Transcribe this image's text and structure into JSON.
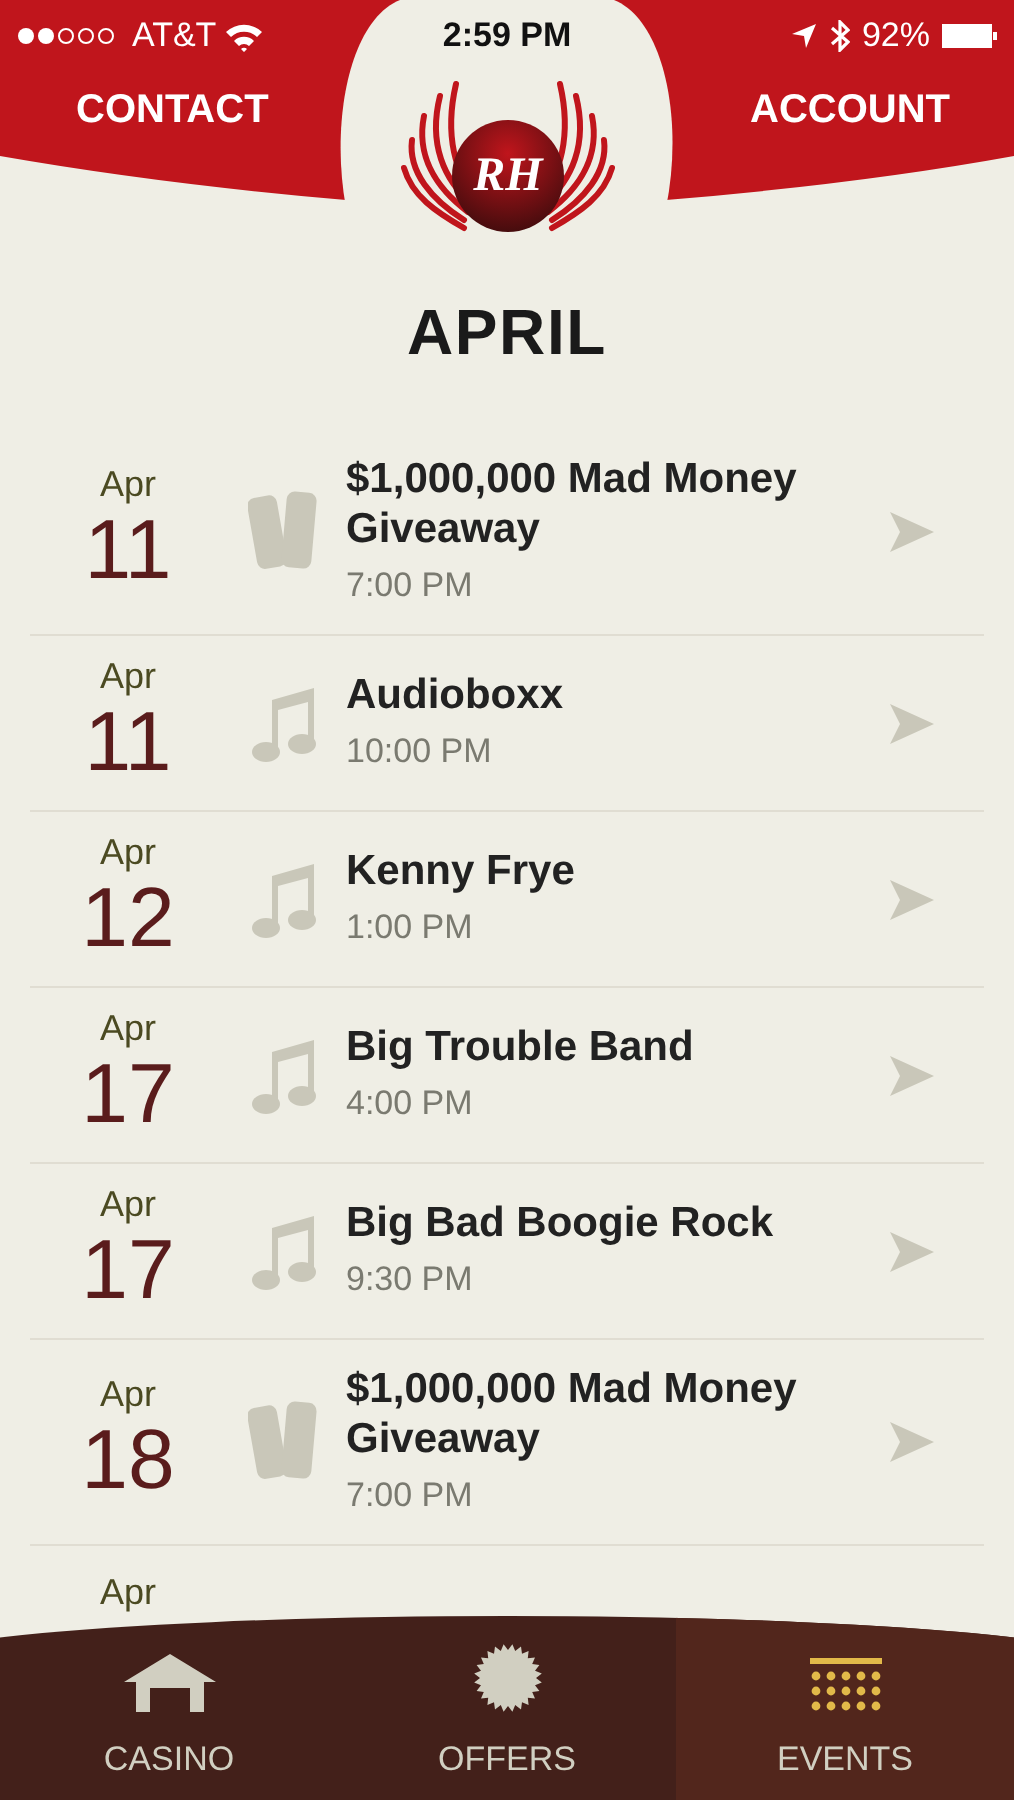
{
  "status_bar": {
    "carrier": "AT&T",
    "time": "2:59 PM",
    "battery": "92%"
  },
  "header": {
    "left": "CONTACT",
    "right": "ACCOUNT",
    "logo_text": "RH"
  },
  "month_title": "APRIL",
  "events": [
    {
      "month": "Apr",
      "day": "11",
      "kind": "tickets",
      "title": "$1,000,000 Mad Money Giveaway",
      "time": "7:00 PM"
    },
    {
      "month": "Apr",
      "day": "11",
      "kind": "music",
      "title": "Audioboxx",
      "time": "10:00 PM"
    },
    {
      "month": "Apr",
      "day": "12",
      "kind": "music",
      "title": "Kenny Frye",
      "time": "1:00 PM"
    },
    {
      "month": "Apr",
      "day": "17",
      "kind": "music",
      "title": "Big Trouble Band",
      "time": "4:00 PM"
    },
    {
      "month": "Apr",
      "day": "17",
      "kind": "music",
      "title": "Big Bad Boogie Rock",
      "time": "9:30 PM"
    },
    {
      "month": "Apr",
      "day": "18",
      "kind": "tickets",
      "title": "$1,000,000 Mad Money Giveaway",
      "time": "7:00 PM"
    }
  ],
  "partial_row": {
    "month": "Apr"
  },
  "tabs": [
    {
      "kind": "house",
      "label": "CASINO",
      "selected": false
    },
    {
      "kind": "burst",
      "label": "OFFERS",
      "selected": false
    },
    {
      "kind": "calendar",
      "label": "EVENTS",
      "selected": true
    }
  ]
}
